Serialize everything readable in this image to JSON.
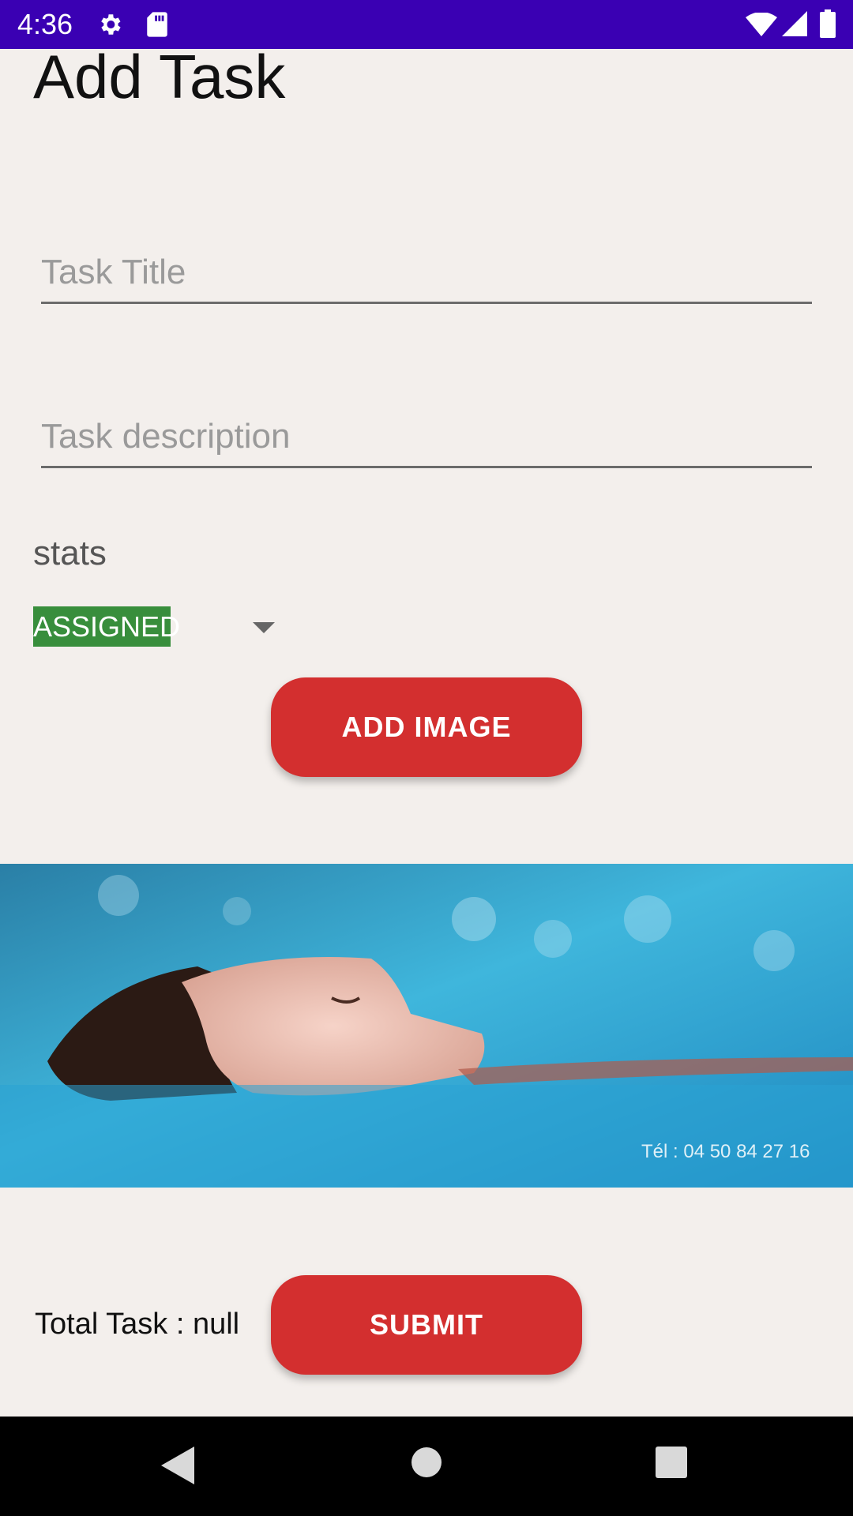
{
  "status_bar": {
    "time": "4:36",
    "icons": [
      "settings-icon",
      "sd-card-icon",
      "wifi-icon",
      "signal-icon",
      "battery-icon"
    ],
    "color": "#3a00b3"
  },
  "page": {
    "title": "Add Task"
  },
  "form": {
    "title_placeholder": "Task Title",
    "description_placeholder": "Task description",
    "stats_label": "stats",
    "stats_selected": "ASSIGNED",
    "add_image_label": "ADD IMAGE",
    "image_caption": "Tél : 04 50 84 27 16"
  },
  "footer": {
    "total_label": "Total Task : null",
    "submit_label": "SUBMIT"
  },
  "colors": {
    "background": "#f3efec",
    "button": "#d32f2f",
    "spinner_highlight": "#388e3c"
  }
}
